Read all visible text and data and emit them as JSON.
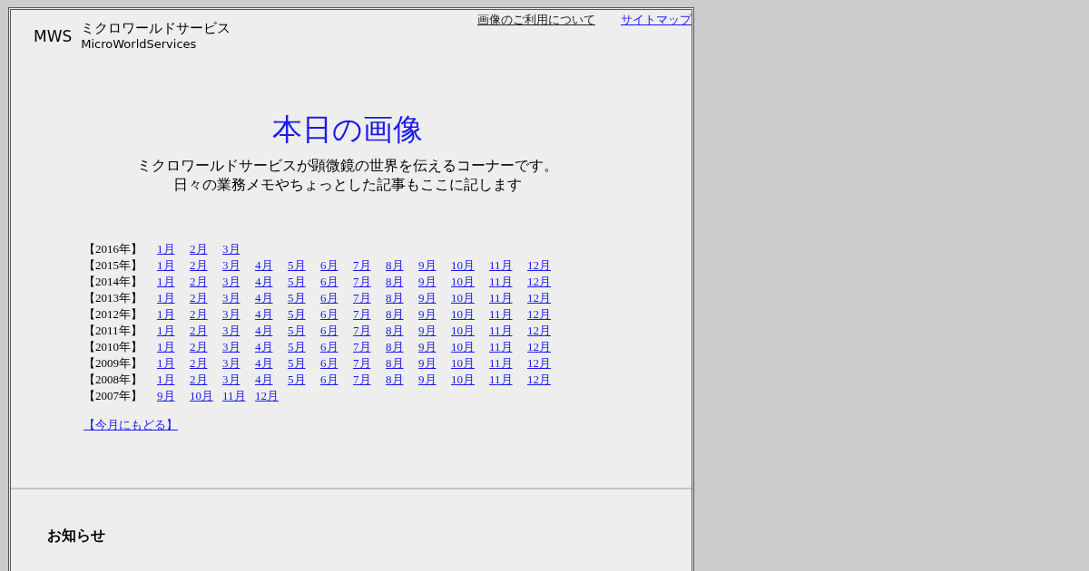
{
  "logo": {
    "mark": "MWS",
    "name_ja": "ミクロワールドサービス",
    "name_en": "MicroWorldServices"
  },
  "top_links": [
    {
      "label": "画像のご利用について",
      "visited": true
    },
    {
      "label": "サイトマップ",
      "visited": false
    }
  ],
  "title": "本日の画像",
  "description": [
    "ミクロワールドサービスが顕微鏡の世界を伝えるコーナーです。",
    "日々の業務メモやちょっとした記事もここに記します"
  ],
  "archive": [
    {
      "year": "【2016年】",
      "months": [
        "1月",
        "2月",
        "3月"
      ]
    },
    {
      "year": "【2015年】",
      "months": [
        "1月",
        "2月",
        "3月",
        "4月",
        "5月",
        "6月",
        "7月",
        "8月",
        "9月",
        "10月",
        "11月",
        "12月"
      ]
    },
    {
      "year": "【2014年】",
      "months": [
        "1月",
        "2月",
        "3月",
        "4月",
        "5月",
        "6月",
        "7月",
        "8月",
        "9月",
        "10月",
        "11月",
        "12月"
      ]
    },
    {
      "year": "【2013年】",
      "months": [
        "1月",
        "2月",
        "3月",
        "4月",
        "5月",
        "6月",
        "7月",
        "8月",
        "9月",
        "10月",
        "11月",
        "12月"
      ]
    },
    {
      "year": "【2012年】",
      "months": [
        "1月",
        "2月",
        "3月",
        "4月",
        "5月",
        "6月",
        "7月",
        "8月",
        "9月",
        "10月",
        "11月",
        "12月"
      ]
    },
    {
      "year": "【2011年】",
      "months": [
        "1月",
        "2月",
        "3月",
        "4月",
        "5月",
        "6月",
        "7月",
        "8月",
        "9月",
        "10月",
        "11月",
        "12月"
      ]
    },
    {
      "year": "【2010年】",
      "months": [
        "1月",
        "2月",
        "3月",
        "4月",
        "5月",
        "6月",
        "7月",
        "8月",
        "9月",
        "10月",
        "11月",
        "12月"
      ]
    },
    {
      "year": "【2009年】",
      "months": [
        "1月",
        "2月",
        "3月",
        "4月",
        "5月",
        "6月",
        "7月",
        "8月",
        "9月",
        "10月",
        "11月",
        "12月"
      ]
    },
    {
      "year": "【2008年】",
      "months": [
        "1月",
        "2月",
        "3月",
        "4月",
        "5月",
        "6月",
        "7月",
        "8月",
        "9月",
        "10月",
        "11月",
        "12月"
      ]
    },
    {
      "year": "【2007年】",
      "months": [
        "9月",
        "10月",
        "11月",
        "12月"
      ]
    }
  ],
  "back_link": "【今月にもどる】",
  "notice_heading": "お知らせ"
}
